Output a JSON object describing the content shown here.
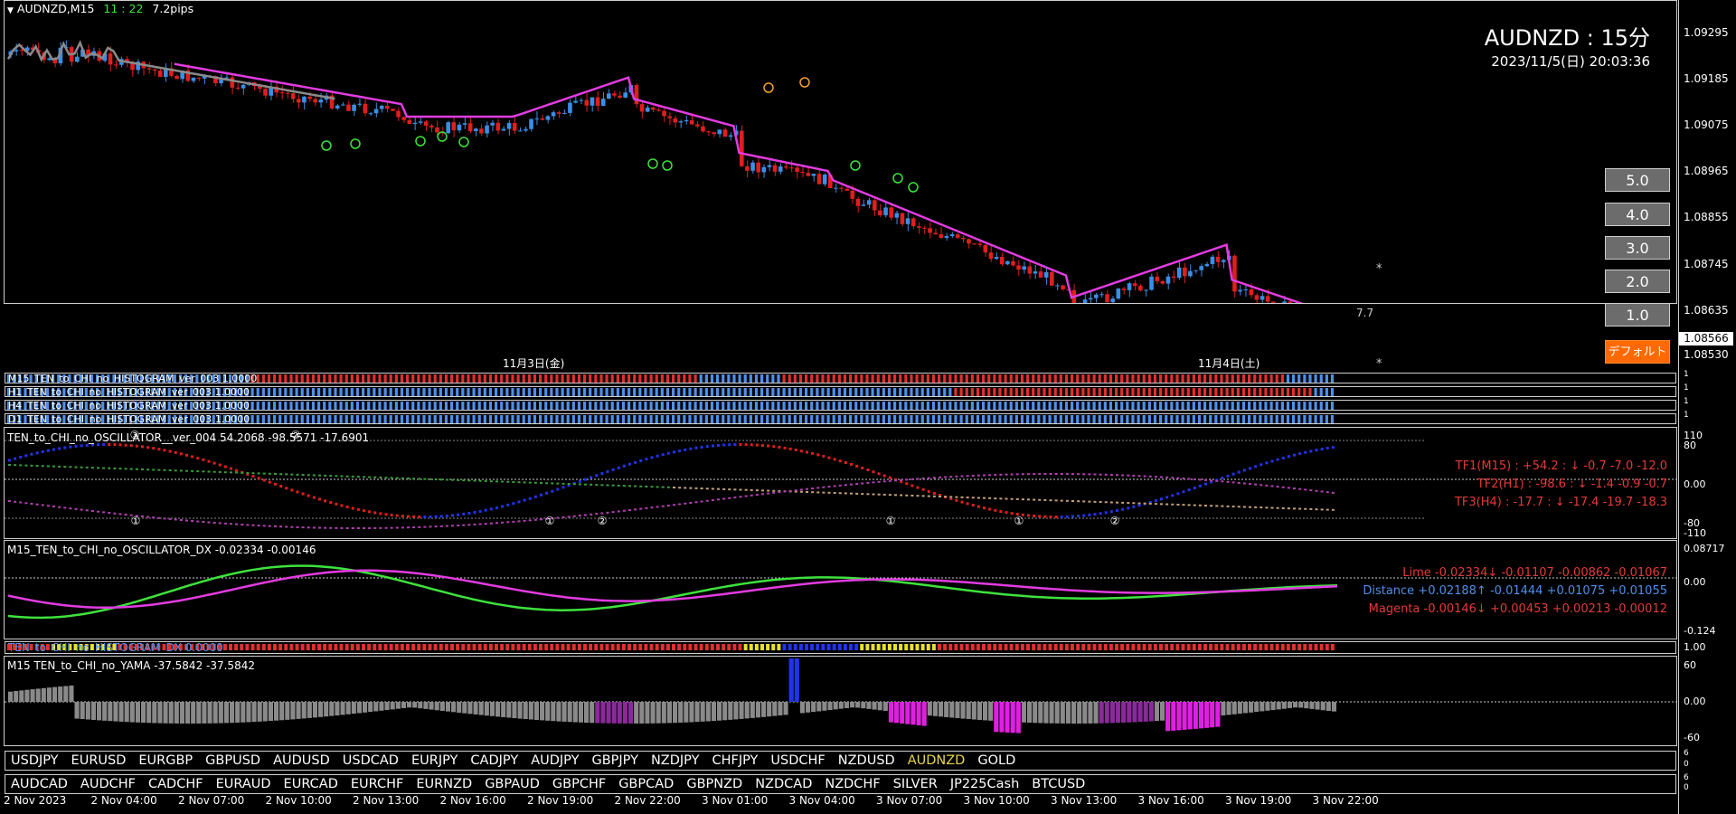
{
  "header": {
    "symbol_tf": "AUDNZD,M15",
    "countdown": "11 : 22",
    "spread": "7.2pips"
  },
  "overlay": {
    "title": "AUDNZD : 15分",
    "datetime": "2023/11/5(日) 20:03:36"
  },
  "price_scale": [
    "1.09295",
    "1.09185",
    "1.09075",
    "1.08965",
    "1.08855",
    "1.08745",
    "1.08635",
    "1.08530"
  ],
  "current_price": "1.08566",
  "tf_buttons": [
    "5.0",
    "4.0",
    "3.0",
    "2.0",
    "1.0"
  ],
  "default_button": "デフォルト",
  "chart_marks": {
    "level_value": "7.7",
    "star1": "*",
    "star2": "*"
  },
  "day_labels": [
    "11月3日(金)",
    "11月4日(土)"
  ],
  "histograms": [
    {
      "label": "M15_TEN_to_CHI_no_HISTOGRAM_ver_003 1.0000",
      "scale_top": "1",
      "scale_bot": "0"
    },
    {
      "label": "H1_TEN_to_CHI_no_HISTOGRAM_ver_003 1.0000",
      "scale_top": "1",
      "scale_bot": "0"
    },
    {
      "label": "H4_TEN_to_CHI_no_HISTOGRAM_ver_003 1.0000",
      "scale_top": "1",
      "scale_bot": "0"
    },
    {
      "label": "D1_TEN_to_CHI_no_HISTOGRAM_ver_003 1.0000",
      "scale_top": "1",
      "scale_bot": "0"
    }
  ],
  "oscillator": {
    "title": "TEN_to_CHI_no_OSCILLATOR__ver_004 54.2068 -98.5571 -17.6901",
    "scale": [
      "110",
      "80",
      "0.00",
      "-80",
      "-110"
    ],
    "tf_lines": [
      "TF1(M15) : +54.2 : ↓ -0.7 -7.0 -12.0",
      "TF2(H1) : -98.6 : ↓ -1.4 -0.9 -0.7",
      "TF3(H4) : -17.7 : ↓ -17.4 -19.7 -18.3"
    ],
    "markers": [
      "①",
      "②",
      "③"
    ]
  },
  "dx": {
    "title": "M15_TEN_to_CHI_no_OSCILLATOR_DX -0.02334 -0.00146",
    "scale": [
      "0.08717",
      "0.00",
      "-0.124"
    ],
    "lines": [
      {
        "label": "Lime -0.02334↓ -0.01107 -0.00862 -0.01067",
        "color": "#e23a3a"
      },
      {
        "label": "Distance +0.02188↑ -0.01444 +0.01075 +0.01055",
        "color": "#4f8fe8"
      },
      {
        "label": "Magenta -0.00146↓ +0.00453 +0.00213 -0.00012",
        "color": "#e23a3a"
      }
    ]
  },
  "hist_dx": {
    "label": "TEN_to_CHI_no_HISTOGRAM_DX 0.0000",
    "scale_top": "1.00",
    "scale_bot": "0.00"
  },
  "yama": {
    "title": "M15 TEN_to_CHI_no_YAMA -37.5842 -37.5842",
    "scale": [
      "60",
      "0.00",
      "-60"
    ]
  },
  "symbols_row1": [
    "USDJPY",
    "EURUSD",
    "EURGBP",
    "GBPUSD",
    "AUDUSD",
    "USDCAD",
    "EURJPY",
    "CADJPY",
    "AUDJPY",
    "GBPJPY",
    "NZDJPY",
    "CHFJPY",
    "USDCHF",
    "NZDUSD",
    "AUDNZD",
    "GOLD"
  ],
  "symbols_row1_active": "AUDNZD",
  "symbols_row2": [
    "AUDCAD",
    "AUDCHF",
    "CADCHF",
    "EURAUD",
    "EURCAD",
    "EURCHF",
    "EURNZD",
    "GBPAUD",
    "GBPCHF",
    "GBPCAD",
    "GBPNZD",
    "NZDCAD",
    "NZDCHF",
    "SILVER",
    "JP225Cash",
    "BTCUSD"
  ],
  "row_scales": [
    "6",
    "0",
    "6",
    "0"
  ],
  "time_axis": [
    "2 Nov 2023",
    "2 Nov 04:00",
    "2 Nov 07:00",
    "2 Nov 10:00",
    "2 Nov 13:00",
    "2 Nov 16:00",
    "2 Nov 19:00",
    "2 Nov 22:00",
    "3 Nov 01:00",
    "3 Nov 04:00",
    "3 Nov 07:00",
    "3 Nov 10:00",
    "3 Nov 13:00",
    "3 Nov 16:00",
    "3 Nov 19:00",
    "3 Nov 22:00"
  ],
  "colors": {
    "bull": "#3a8ee6",
    "bear": "#e01e1e",
    "ma": "#e23ce0",
    "ma_grey": "#8a8a8a",
    "lime": "#3ee23e",
    "magenta": "#e23ce0"
  }
}
